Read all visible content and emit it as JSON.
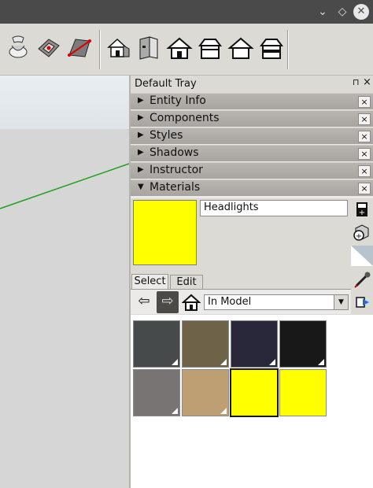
{
  "window": {
    "controls": {
      "minimize": "⌄",
      "maximize": "◇",
      "close": "✕"
    }
  },
  "toolbar": {
    "tools": [
      "sandbox-drape-icon",
      "sandbox-stamp-icon",
      "sandbox-flip-edge-icon",
      "warehouse-3d-icon",
      "extension-warehouse-icon",
      "house-icon",
      "house-roof-icon",
      "house-outline-icon",
      "house-share-icon"
    ]
  },
  "tray": {
    "title": "Default Tray",
    "pin": "⊓",
    "close": "×",
    "panels": [
      {
        "label": "Entity Info",
        "arrow": "▶",
        "close": "×"
      },
      {
        "label": "Components",
        "arrow": "▶",
        "close": "×"
      },
      {
        "label": "Styles",
        "arrow": "▶",
        "close": "×"
      },
      {
        "label": "Shadows",
        "arrow": "▶",
        "close": "×"
      },
      {
        "label": "Instructor",
        "arrow": "▶",
        "close": "×"
      },
      {
        "label": "Materials",
        "arrow": "▼",
        "close": "×"
      }
    ]
  },
  "materials": {
    "current_name": "Headlights",
    "current_color": "#ffff00",
    "tabs": {
      "select": "Select",
      "edit": "Edit"
    },
    "nav": {
      "back": "⇦",
      "forward": "⇨"
    },
    "collection": "In Model",
    "collection_arrow": "▼",
    "swatches": [
      {
        "color": "#464a4a"
      },
      {
        "color": "#6e6248"
      },
      {
        "color": "#28283a"
      },
      {
        "color": "#181818"
      },
      {
        "color": "#787474"
      },
      {
        "color": "#be9f74"
      },
      {
        "color": "#ffff00",
        "selected": true
      },
      {
        "color": "#ffff00"
      }
    ]
  },
  "colors": {
    "axis_green": "#1aa01a",
    "selection_yellow": "#ffff00"
  }
}
